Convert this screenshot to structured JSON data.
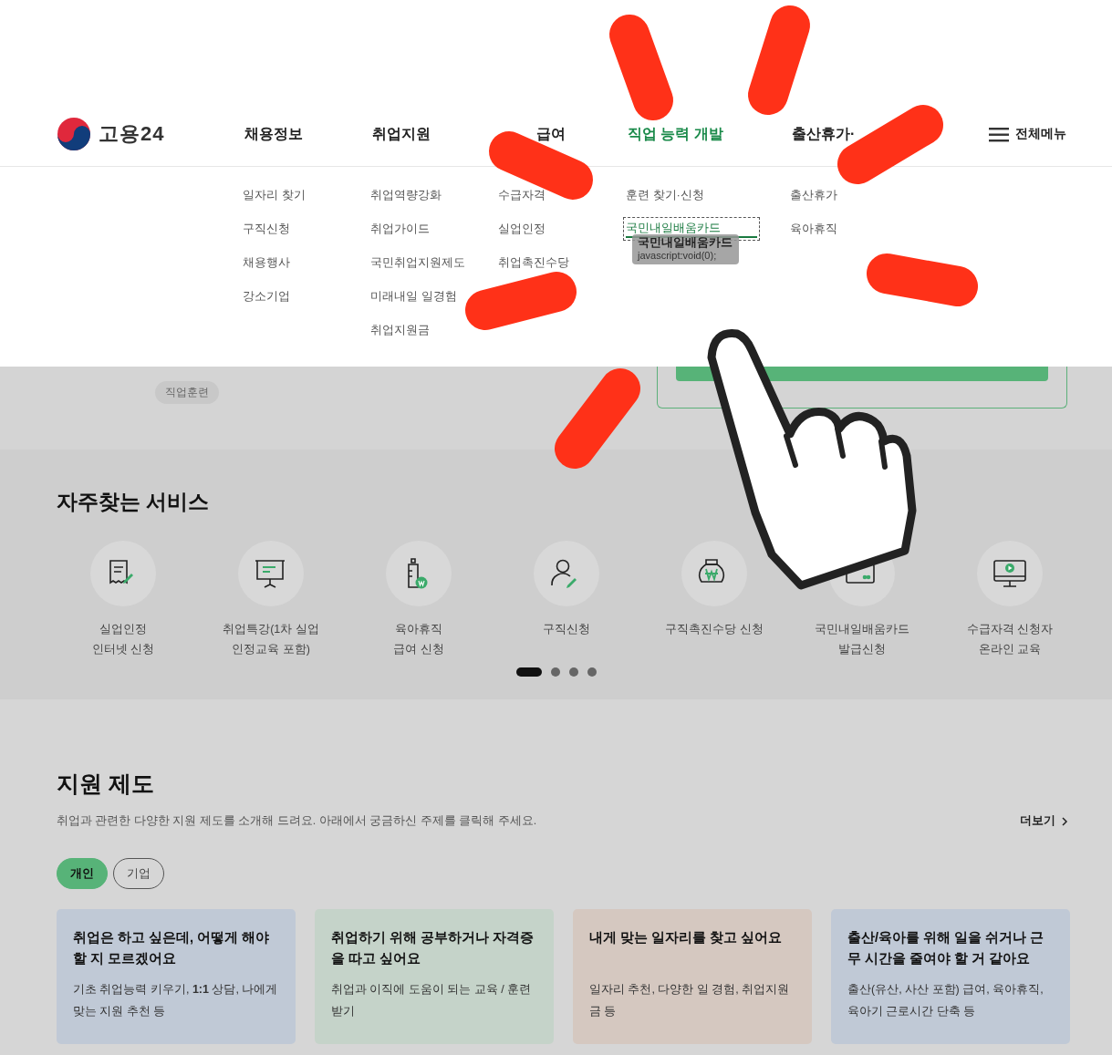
{
  "header": {
    "logo": "고용24",
    "nav": [
      {
        "label": "채용정보",
        "selected": false
      },
      {
        "label": "취업지원",
        "selected": false
      },
      {
        "label": "급여",
        "selected": false
      },
      {
        "label": "직업 능력 개발",
        "selected": true
      },
      {
        "label": "출산휴가·",
        "selected": false
      }
    ],
    "all_menu": "전체메뉴"
  },
  "mega_menu": {
    "columns": [
      {
        "items": [
          {
            "label": "일자리 찾기",
            "focused": false
          },
          {
            "label": "구직신청",
            "focused": false
          },
          {
            "label": "채용행사",
            "focused": false
          },
          {
            "label": "강소기업",
            "focused": false
          }
        ]
      },
      {
        "items": [
          {
            "label": "취업역량강화",
            "focused": false
          },
          {
            "label": "취업가이드",
            "focused": false
          },
          {
            "label": "국민취업지원제도",
            "focused": false
          },
          {
            "label": "미래내일 일경험",
            "focused": false
          },
          {
            "label": "취업지원금",
            "focused": false
          }
        ]
      },
      {
        "items": [
          {
            "label": "수급자격",
            "focused": false
          },
          {
            "label": "실업인정",
            "focused": false
          },
          {
            "label": "취업촉진수당",
            "focused": false
          }
        ]
      },
      {
        "items": [
          {
            "label": "훈련 찾기·신청",
            "focused": false
          },
          {
            "label": "국민내일배움카드",
            "focused": true
          }
        ]
      },
      {
        "items": [
          {
            "label": "출산휴가",
            "focused": false
          },
          {
            "label": "육아휴직",
            "focused": false
          }
        ]
      }
    ]
  },
  "tooltip": {
    "title": "국민내일배움카드",
    "url": "javascript:void(0);"
  },
  "behind": {
    "chips": [
      "직업훈련"
    ]
  },
  "services": {
    "title": "자주찾는 서비스",
    "items": [
      {
        "label": "실업인정\n인터넷 신청",
        "kind": "receipt"
      },
      {
        "label": "취업특강(1차 실업\n인정교육 포함)",
        "kind": "presentation"
      },
      {
        "label": "육아휴직\n급여 신청",
        "kind": "bottle"
      },
      {
        "label": "구직신청",
        "kind": "person"
      },
      {
        "label": "구직촉진수당 신청",
        "kind": "moneybag"
      },
      {
        "label": "국민내일배움카드\n발급신청",
        "kind": "card"
      },
      {
        "label": "수급자격 신청자\n온라인 교육",
        "kind": "monitor"
      }
    ],
    "pages": [
      {
        "selected": true
      },
      {
        "selected": false
      },
      {
        "selected": false
      },
      {
        "selected": false
      }
    ]
  },
  "support": {
    "title": "지원 제도",
    "description": "취업과 관련한 다양한 지원 제도를 소개해 드려요. 아래에서 궁금하신 주제를 클릭해 주세요.",
    "more": "더보기",
    "tabs": [
      {
        "label": "개인",
        "selected": true
      },
      {
        "label": "기업",
        "selected": false
      }
    ],
    "cards": [
      {
        "title": "취업은 하고 싶은데, 어떻게 해야 할 지 모르겠어요",
        "description": "기초 취업능력 키우기, **1:1** 상담, 나에게 맞는 지원 추천 등",
        "color": "#c0c9d6"
      },
      {
        "title": "취업하기 위해 공부하거나 자격증을 따고 싶어요",
        "description": "취업과 이직에 도움이 되는 교육 / 훈련 받기",
        "color": "#c5d3c9"
      },
      {
        "title": "내게 맞는 일자리를 찾고 싶어요",
        "description": "일자리 추천, 다양한 일 경험, 취업지원금 등",
        "color": "#d5c8c0"
      },
      {
        "title": "출산/육아를 위해 일을 쉬거나 근무 시간을 줄여야 할 거 같아요",
        "description": "출산(유산, 사산 포함) 급여, 육아휴직, 육아기 근로시간 단축 등",
        "color": "#c0c9d6"
      }
    ]
  }
}
